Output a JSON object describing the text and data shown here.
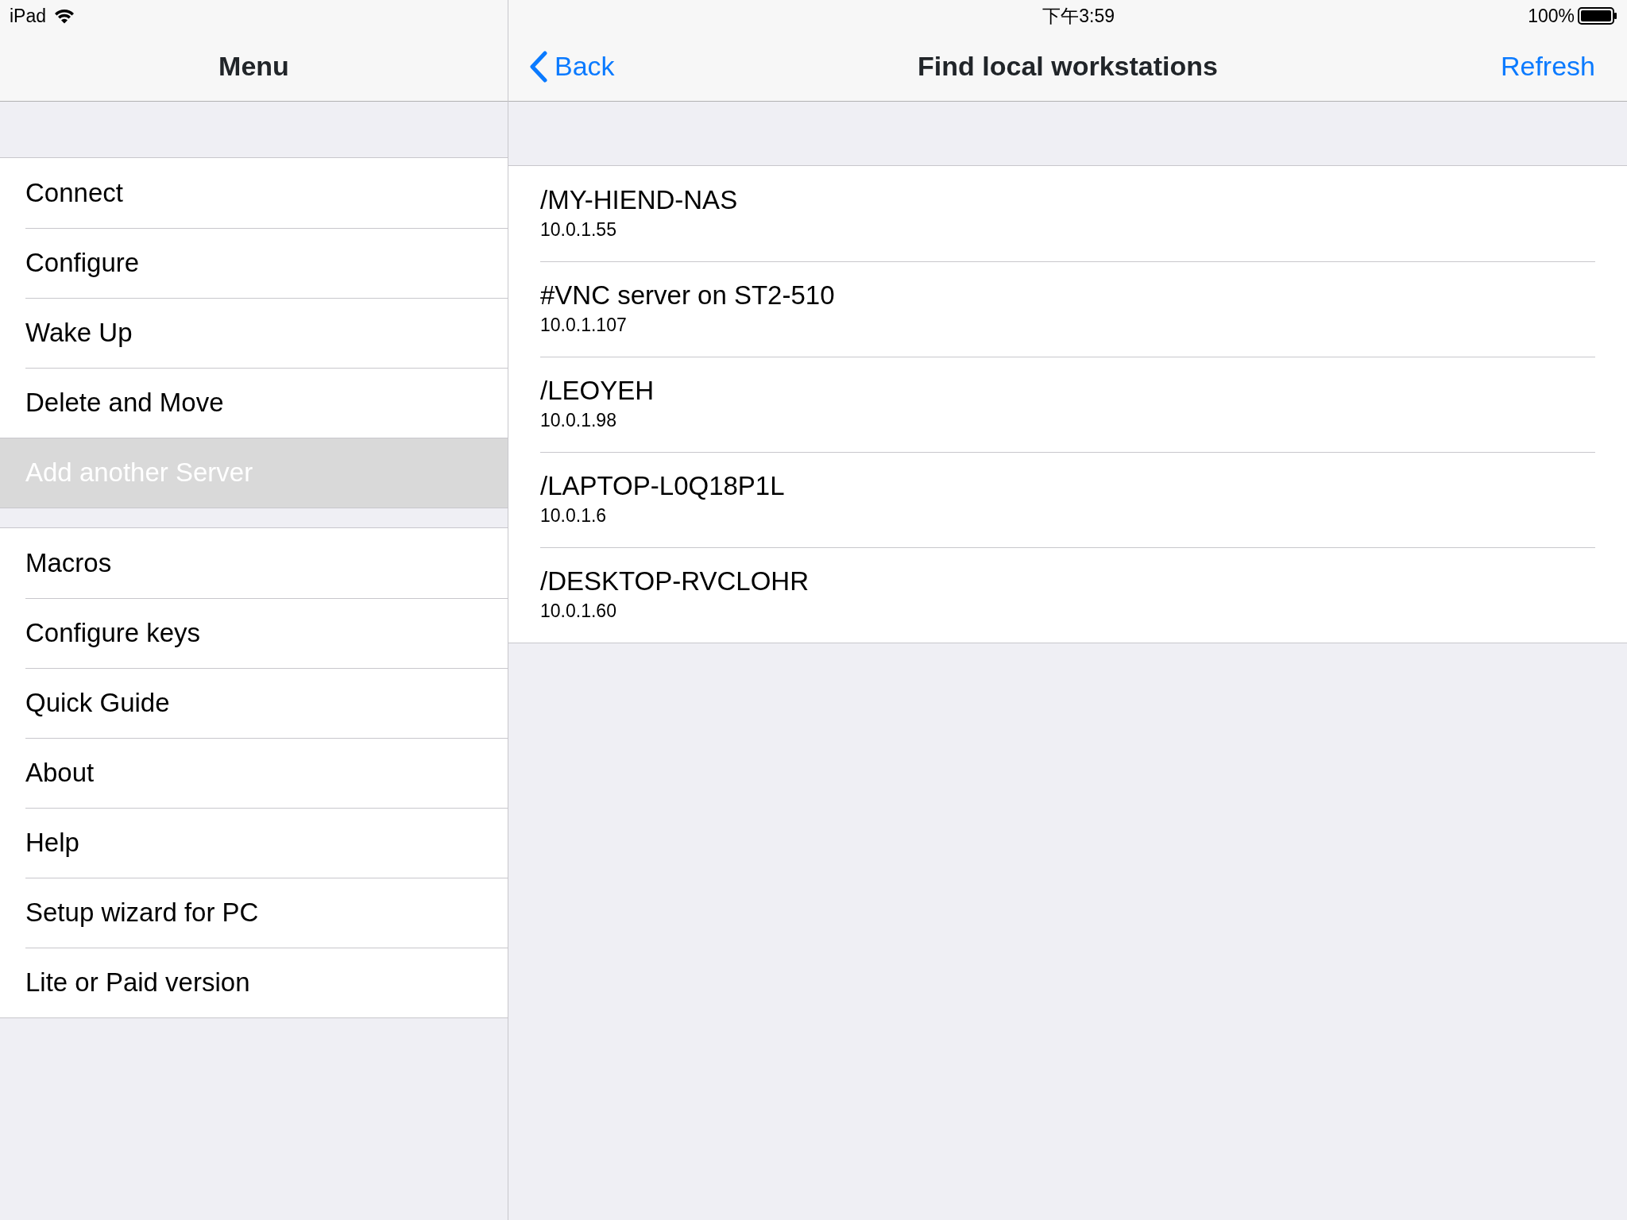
{
  "status_bar": {
    "device": "iPad",
    "time": "下午3:59",
    "battery": "100%"
  },
  "menu": {
    "title": "Menu",
    "groups": [
      {
        "items": [
          {
            "label": "Connect",
            "selected": false
          },
          {
            "label": "Configure",
            "selected": false
          },
          {
            "label": "Wake Up",
            "selected": false
          },
          {
            "label": "Delete and Move",
            "selected": false
          },
          {
            "label": "Add another Server",
            "selected": true
          }
        ]
      },
      {
        "items": [
          {
            "label": "Macros",
            "selected": false
          },
          {
            "label": "Configure keys",
            "selected": false
          },
          {
            "label": "Quick Guide",
            "selected": false
          },
          {
            "label": "About",
            "selected": false
          },
          {
            "label": "Help",
            "selected": false
          },
          {
            "label": "Setup wizard for PC",
            "selected": false
          },
          {
            "label": "Lite or Paid version",
            "selected": false
          }
        ]
      }
    ]
  },
  "detail": {
    "back": "Back",
    "title": "Find local workstations",
    "refresh": "Refresh",
    "workstations": [
      {
        "name": "/MY-HIEND-NAS",
        "address": "10.0.1.55"
      },
      {
        "name": "#VNC server on ST2-510",
        "address": "10.0.1.107"
      },
      {
        "name": "/LEOYEH",
        "address": "10.0.1.98"
      },
      {
        "name": "/LAPTOP-L0Q18P1L",
        "address": "10.0.1.6"
      },
      {
        "name": "/DESKTOP-RVCLOHR",
        "address": "10.0.1.60"
      }
    ]
  }
}
